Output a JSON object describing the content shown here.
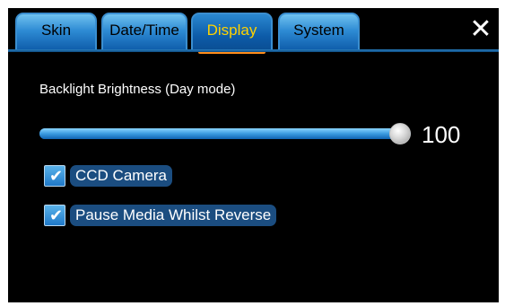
{
  "tabs": [
    {
      "label": "Skin",
      "active": false
    },
    {
      "label": "Date/Time",
      "active": false
    },
    {
      "label": "Display",
      "active": true
    },
    {
      "label": "System",
      "active": false
    }
  ],
  "close_icon": "close-icon",
  "brightness": {
    "label": "Backlight Brightness (Day mode)",
    "value": 100,
    "value_text": "100",
    "min": 0,
    "max": 100
  },
  "options": [
    {
      "label": "CCD Camera",
      "checked": true
    },
    {
      "label": "Pause Media Whilst Reverse",
      "checked": true
    }
  ],
  "colors": {
    "active_tab_text": "#ffd200",
    "active_tab_underline": "#ff8c1a",
    "accent_blue": "#2d8ad3",
    "background": "#000000"
  }
}
